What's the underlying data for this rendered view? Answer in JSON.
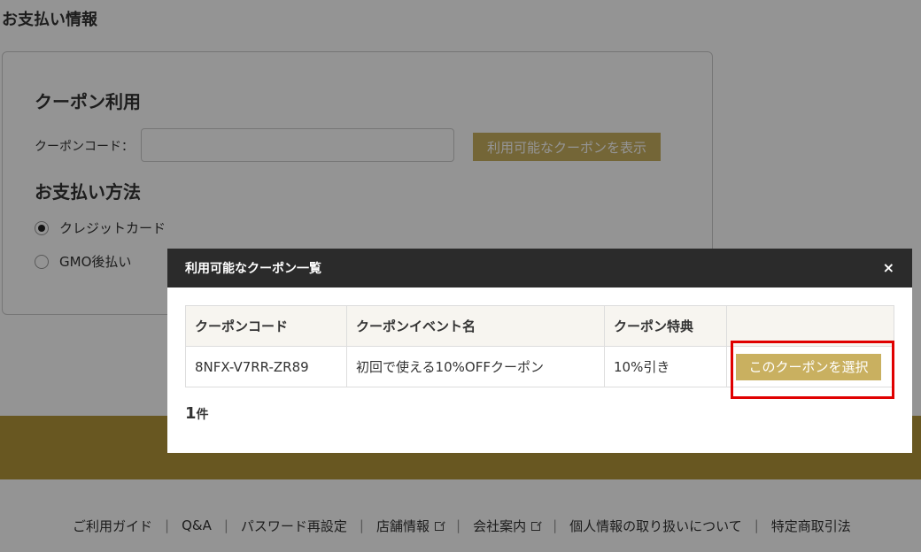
{
  "page": {
    "section_title": "お支払い情報",
    "coupon_heading": "クーポン利用",
    "coupon_label": "クーポンコード：",
    "coupon_input_value": "",
    "show_coupons_button": "利用可能なクーポンを表示",
    "payment_heading": "お支払い方法",
    "payment_options": [
      {
        "label": "クレジットカード",
        "selected": true
      },
      {
        "label": "GMO後払い",
        "selected": false
      }
    ]
  },
  "footer": {
    "links": [
      "ご利用ガイド",
      "Q&A",
      "パスワード再設定",
      "店舗情報",
      "会社案内",
      "個人情報の取り扱いについて",
      "特定商取引法"
    ]
  },
  "modal": {
    "title": "利用可能なクーポン一覧",
    "close_glyph": "×",
    "columns": [
      "クーポンコード",
      "クーポンイベント名",
      "クーポン特典",
      ""
    ],
    "rows": [
      {
        "code": "8NFX-V7RR-ZR89",
        "event": "初回で使える10%OFFクーポン",
        "benefit": "10%引き",
        "action": "このクーポンを選択"
      }
    ],
    "count_number": "1",
    "count_unit": "件"
  },
  "colors": {
    "accent_gold": "#c9b060",
    "band_gold": "#b4963a",
    "modal_header": "#2b2b2b",
    "highlight": "#e00000"
  }
}
